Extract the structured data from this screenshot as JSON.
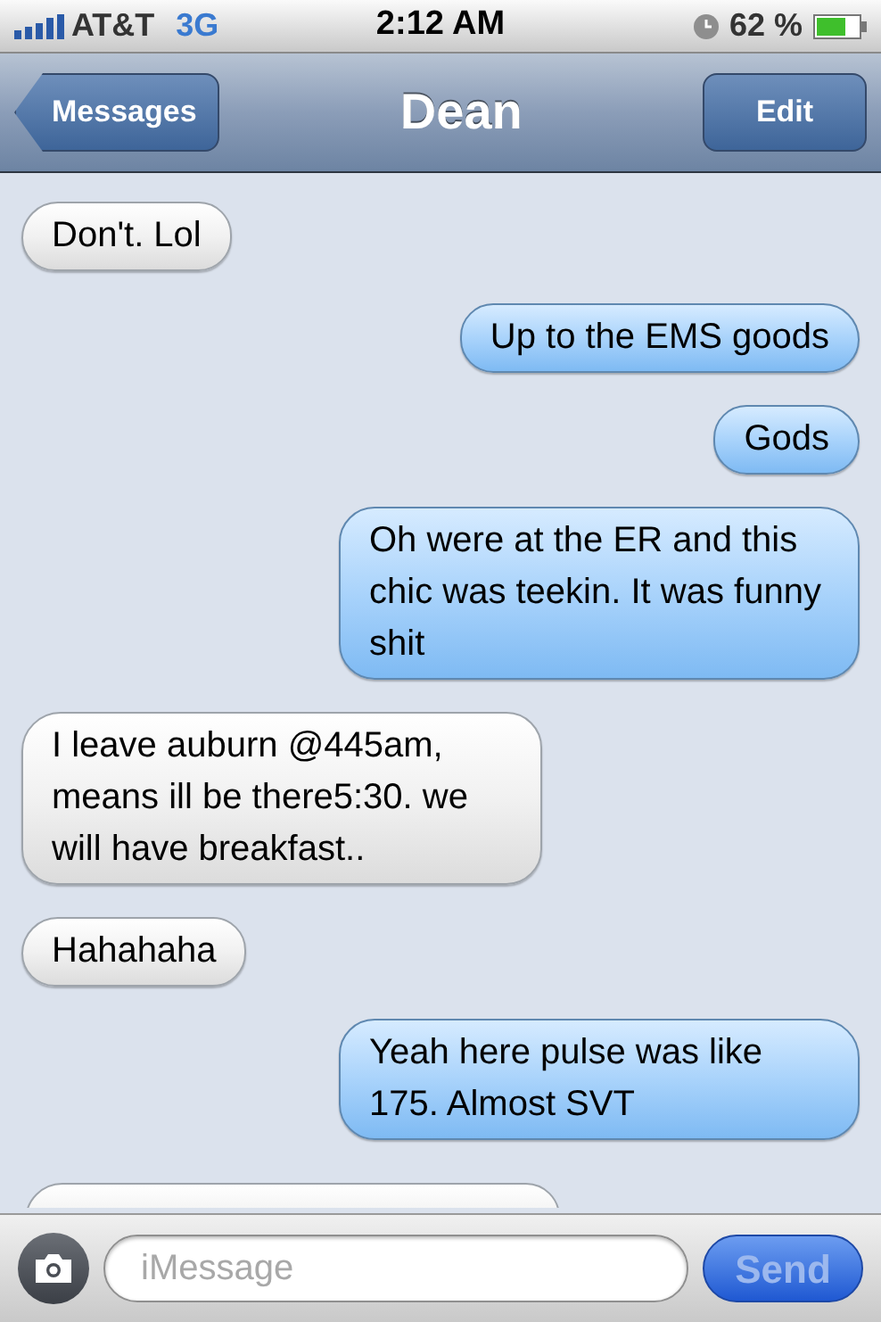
{
  "status_bar": {
    "carrier": "AT&T",
    "network": "3G",
    "time": "2:12 AM",
    "battery": "62 %"
  },
  "nav_bar": {
    "back": "Messages",
    "title": "Dean",
    "action": "Edit"
  },
  "messages": [
    {
      "kind": "incoming",
      "cut_off": false,
      "text": "Don't. Lol"
    },
    {
      "kind": "outgoing",
      "cut_off": false,
      "text": "Up to the EMS goods"
    },
    {
      "kind": "outgoing",
      "cut_off": false,
      "text": "Gods"
    },
    {
      "kind": "outgoing",
      "cut_off": false,
      "text": "Oh were at the ER and this chic was teekin. It was funny shit"
    },
    {
      "kind": "incoming",
      "cut_off": false,
      "text": "I leave auburn @445am, means ill be there5:30. we will have breakfast.."
    },
    {
      "kind": "incoming",
      "cut_off": false,
      "text": "Hahahaha"
    },
    {
      "kind": "outgoing",
      "cut_off": false,
      "text": "Yeah here pulse was like 175. Almost SVT"
    },
    {
      "kind": "incoming",
      "cut_off": true
    }
  ],
  "compose": {
    "placeholder": "iMessage",
    "send": "Send",
    "disabled": true
  }
}
